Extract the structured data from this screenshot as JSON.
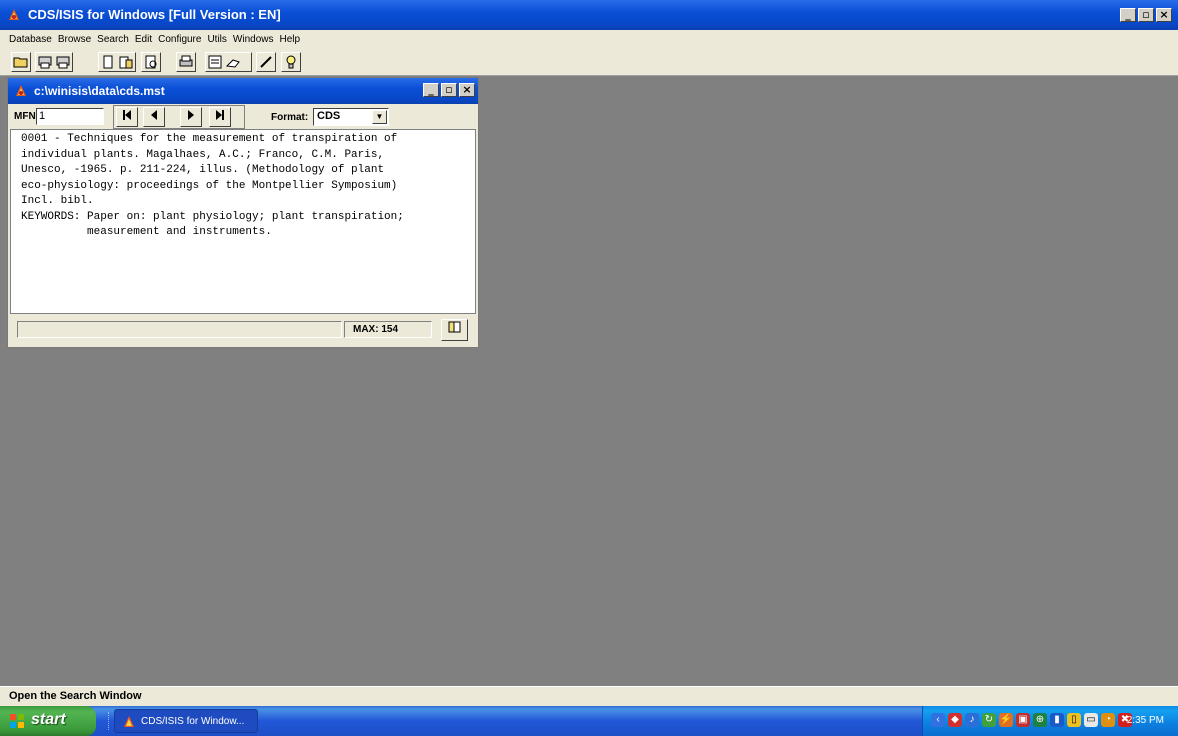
{
  "app": {
    "title": "CDS/ISIS for Windows [Full Version : EN]",
    "window_controls": {
      "minimize": "_",
      "maximize": "▫",
      "close": "×"
    }
  },
  "menu": [
    "Database",
    "Browse",
    "Search",
    "Edit",
    "Configure",
    "Utils",
    "Windows",
    "Help"
  ],
  "toolbar": {
    "buttons": [
      {
        "icon": "open-folder-icon"
      },
      {
        "icon": "print-preview-icon"
      },
      {
        "icon": "print-icon"
      },
      {
        "icon": "copy-icon"
      },
      {
        "icon": "paste-icon"
      },
      {
        "icon": "search-document-icon"
      },
      {
        "icon": "printer-icon"
      },
      {
        "icon": "form-icon"
      },
      {
        "icon": "hand-icon"
      },
      {
        "icon": "pencil-icon"
      },
      {
        "icon": "lightbulb-icon"
      }
    ]
  },
  "record_window": {
    "title": "c:\\winisis\\data\\cds.mst",
    "mfn_label": "MFN",
    "mfn_value": "1",
    "format_label": "Format:",
    "format_value": "CDS",
    "record_text": "0001 - Techniques for the measurement of transpiration of\nindividual plants. Magalhaes, A.C.; Franco, C.M. Paris,\nUnesco, -1965. p. 211-224, illus. (Methodology of plant\neco-physiology: proceedings of the Montpellier Symposium)\nIncl. bibl.\nKEYWORDS: Paper on: plant physiology; plant transpiration;\n          measurement and instruments.",
    "status_text": "",
    "max_text": "MAX: 154"
  },
  "statusbar": {
    "text": "Open the Search Window"
  },
  "taskbar": {
    "start_label": "start",
    "task_label": "CDS/ISIS for Window...",
    "clock": "2:35 PM"
  },
  "colors": {
    "title_blue": "#0a4fd6",
    "desktop_gray": "#808080",
    "chrome": "#ece9d8",
    "start_green": "#3a9a3a"
  }
}
